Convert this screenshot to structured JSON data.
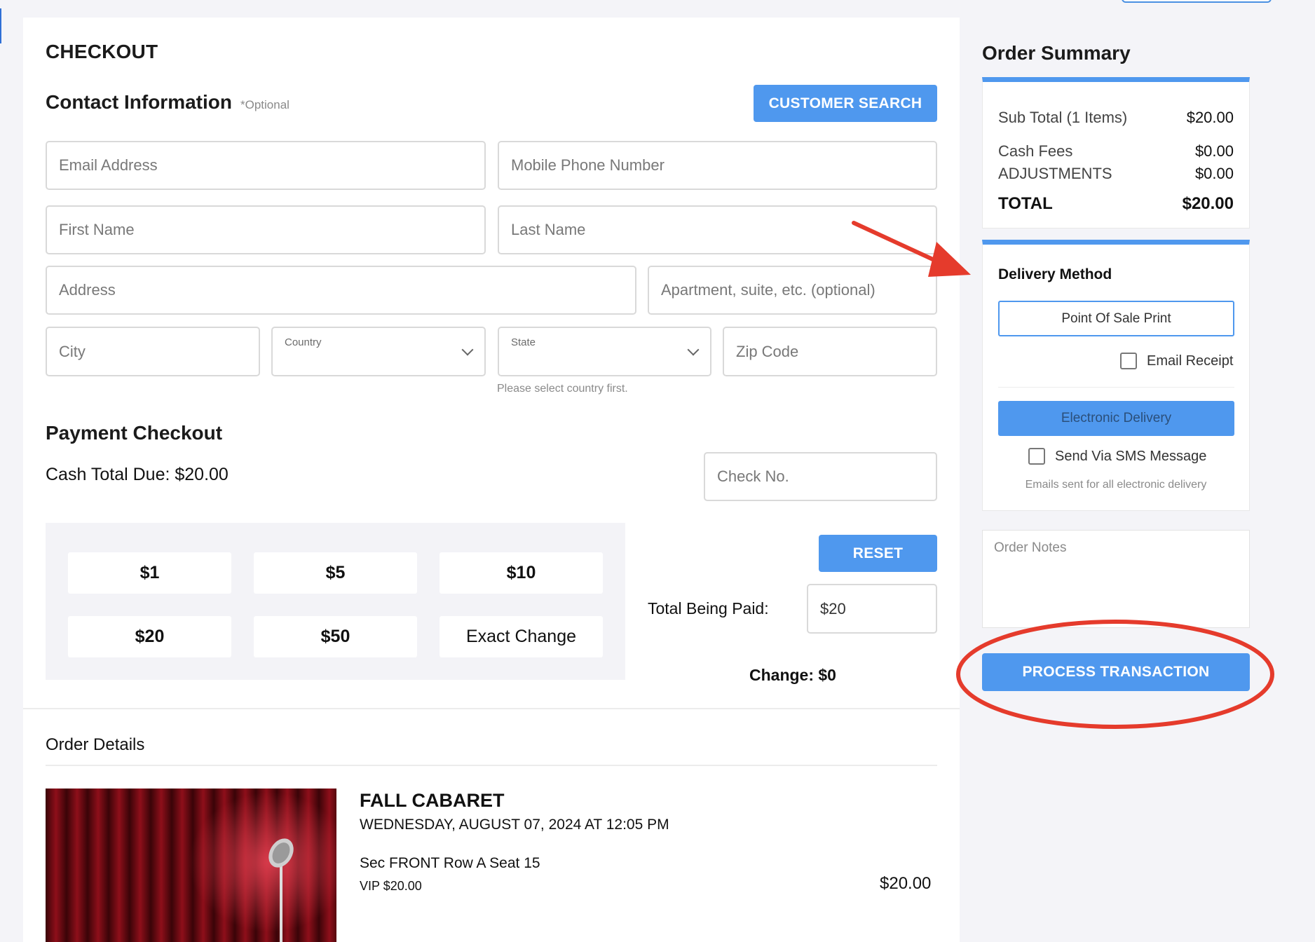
{
  "page": {
    "title": "CHECKOUT"
  },
  "contact": {
    "title": "Contact Information",
    "optional": "*Optional",
    "customer_search": "CUSTOMER SEARCH",
    "email_ph": "Email Address",
    "phone_ph": "Mobile Phone Number",
    "first_ph": "First Name",
    "last_ph": "Last Name",
    "address_ph": "Address",
    "apt_ph": "Apartment, suite, etc. (optional)",
    "city_ph": "City",
    "country_label": "Country",
    "state_label": "State",
    "zip_ph": "Zip Code",
    "state_hint": "Please select country first."
  },
  "payment": {
    "title": "Payment Checkout",
    "cash_total": "Cash Total Due: $20.00",
    "check_ph": "Check No.",
    "cash_buttons": [
      "$1",
      "$5",
      "$10",
      "$20",
      "$50",
      "Exact Change"
    ],
    "reset": "RESET",
    "total_paid_label": "Total Being Paid:",
    "total_paid_value": "$20",
    "change": "Change: $0"
  },
  "order_details": {
    "title": "Order Details",
    "event_name": "FALL CABARET",
    "event_date": "WEDNESDAY, AUGUST 07, 2024 AT 12:05 PM",
    "seat": "Sec FRONT Row A Seat 15",
    "ticket_type": "VIP $20.00",
    "price": "$20.00"
  },
  "summary": {
    "title": "Order Summary",
    "subtotal_label": "Sub Total (1 Items)",
    "subtotal_value": "$20.00",
    "cash_fees_label": "Cash Fees",
    "cash_fees_value": "$0.00",
    "adjustments_label": "ADJUSTMENTS",
    "adjustments_value": "$0.00",
    "total_label": "TOTAL",
    "total_value": "$20.00"
  },
  "delivery": {
    "title": "Delivery Method",
    "pos_print": "Point Of Sale Print",
    "email_receipt": "Email Receipt",
    "electronic": "Electronic Delivery",
    "sms": "Send Via SMS Message",
    "note": "Emails sent for all electronic delivery"
  },
  "notes": {
    "placeholder": "Order Notes"
  },
  "process_button": "PROCESS TRANSACTION",
  "colors": {
    "accent": "#4f98ee",
    "annotation": "#e53b2c"
  }
}
